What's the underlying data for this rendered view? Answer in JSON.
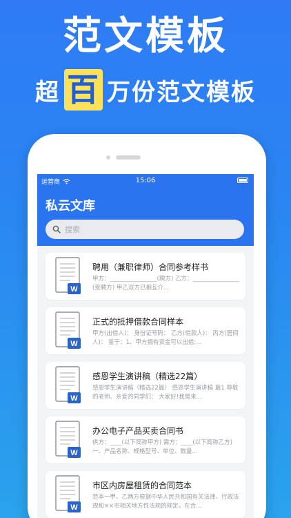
{
  "promo": {
    "title": "范文模板",
    "subtitle_prefix": "超",
    "subtitle_highlight": "百",
    "subtitle_suffix": "万份范文模板"
  },
  "status_bar": {
    "carrier": "运营商",
    "time": "15:06"
  },
  "app": {
    "title": "私云文库",
    "search_placeholder": "搜索"
  },
  "documents": [
    {
      "title": "聘用（兼职律师）合同参考样书",
      "excerpt": "甲方：________________(聘方) 乙方：________________(受聘方) 甲乙双方已相互介..."
    },
    {
      "title": "正式的抵押借款合同样本",
      "excerpt": "甲方(出借人)： 身份证号码： 乙方(借款人)： 丙方(居间人)： 鉴于：1、甲方拥有资金可以出借;..."
    },
    {
      "title": "感恩学生演讲稿（精选22篇）",
      "excerpt": "感恩学生演讲稿（精选22篇） 感恩学生演讲稿 篇1 尊敬的老师、亲爱的同学们： 大家好!我是来..."
    },
    {
      "title": "办公电子产品买卖合同书",
      "excerpt": "供方：____(以下简称甲方) 需方：____(以下简称乙方) 一、产品名称、规格型号、单位、数量..."
    },
    {
      "title": "市区内房屋租赁的合同范本",
      "excerpt": "范本一甲、乙两方根据中华人民共和国有关法律、行政法规和××市相关地方性法规的规定，在合..."
    }
  ],
  "colors": {
    "brand_blue": "#2b74f0",
    "highlight": "#ffe15a",
    "doc_badge": "#2a64c8"
  }
}
